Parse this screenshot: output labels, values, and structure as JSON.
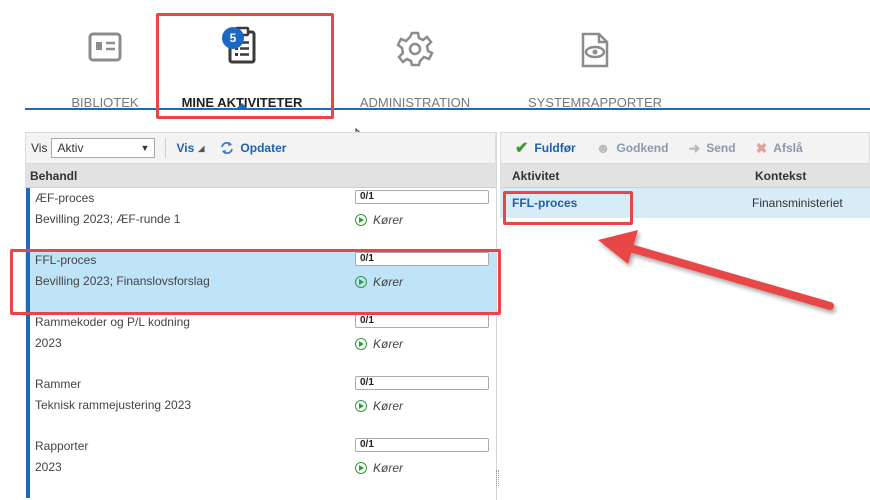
{
  "nav": {
    "items": [
      {
        "label": "BIBLIOTEK",
        "icon": "id-card-icon"
      },
      {
        "label": "MINE AKTIVITETER",
        "icon": "clipboard-list-icon",
        "badge": "5"
      },
      {
        "label": "ADMINISTRATION",
        "icon": "gear-icon"
      },
      {
        "label": "SYSTEMRAPPORTER",
        "icon": "document-eye-icon"
      }
    ]
  },
  "left": {
    "vis_label": "Vis",
    "filter_value": "Aktiv",
    "vis_menu": "Vis",
    "refresh_label": "Opdater",
    "column_header": "Behandl",
    "items": [
      {
        "title": "ÆF-proces",
        "subtitle": "Bevilling 2023; ÆF-runde 1",
        "count": "0/1",
        "status": "Kører"
      },
      {
        "title": "FFL-proces",
        "subtitle": "Bevilling 2023; Finanslovsforslag",
        "count": "0/1",
        "status": "Kører"
      },
      {
        "title": "Rammekoder og P/L kodning",
        "subtitle": "2023",
        "count": "0/1",
        "status": "Kører"
      },
      {
        "title": "Rammer",
        "subtitle": "Teknisk rammejustering 2023",
        "count": "0/1",
        "status": "Kører"
      },
      {
        "title": "Rapporter",
        "subtitle": "2023",
        "count": "0/1",
        "status": "Kører"
      }
    ]
  },
  "right": {
    "toolbar": {
      "complete": "Fuldfør",
      "approve": "Godkend",
      "send": "Send",
      "reject": "Afslå"
    },
    "columns": {
      "activity": "Aktivitet",
      "context": "Kontekst"
    },
    "rows": [
      {
        "activity": "FFL-proces",
        "context": "Finansministeriet"
      }
    ]
  },
  "colors": {
    "accent": "#1f6ab7",
    "highlight": "#e84646",
    "selected": "#bfe3f7",
    "link": "#1f5fae"
  }
}
